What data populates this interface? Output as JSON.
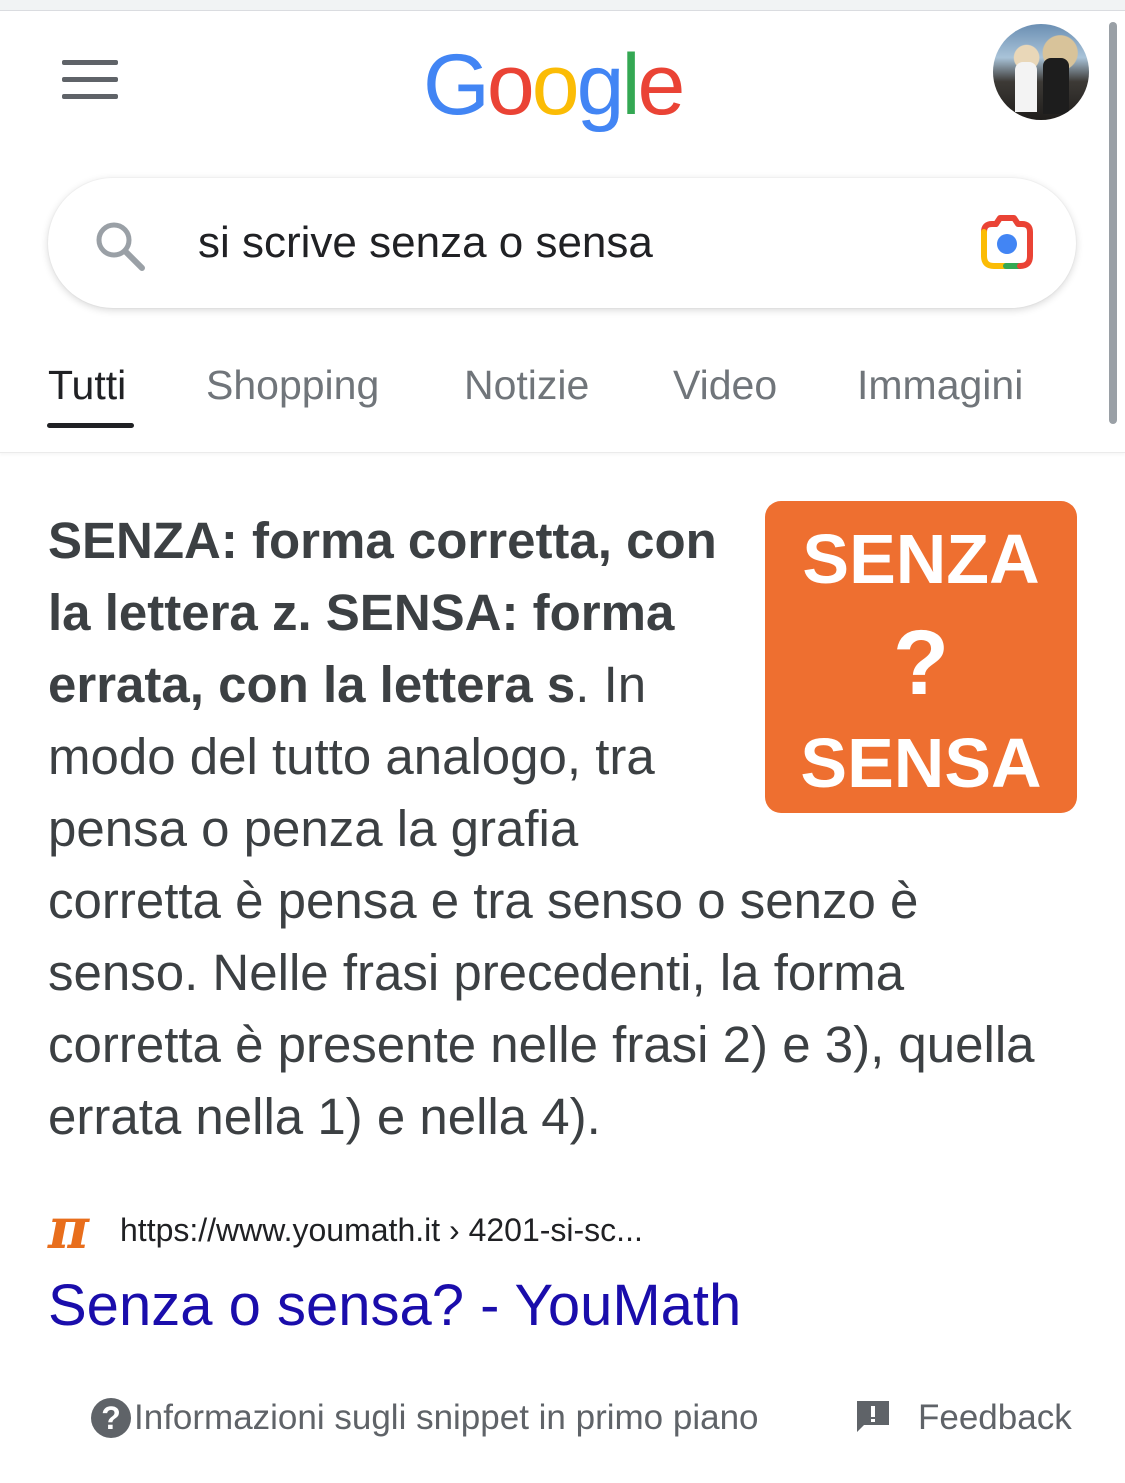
{
  "header": {
    "logo_letters": [
      {
        "char": "G",
        "color": "#4285f4"
      },
      {
        "char": "o",
        "color": "#ea4335"
      },
      {
        "char": "o",
        "color": "#fbbc05"
      },
      {
        "char": "g",
        "color": "#4285f4"
      },
      {
        "char": "l",
        "color": "#34a853"
      },
      {
        "char": "e",
        "color": "#ea4335"
      }
    ],
    "menu_icon": "hamburger-menu-icon",
    "avatar_icon": "account-avatar"
  },
  "search": {
    "query": "si scrive senza o sensa",
    "search_icon": "search-icon",
    "lens_icon": "google-lens-camera-icon"
  },
  "tabs": [
    {
      "label": "Tutti",
      "active": true
    },
    {
      "label": "Shopping",
      "active": false
    },
    {
      "label": "Notizie",
      "active": false
    },
    {
      "label": "Video",
      "active": false
    },
    {
      "label": "Immagini",
      "active": false
    }
  ],
  "snippet": {
    "bold_text": "SENZA: forma corretta, con la lettera z. SENSA: forma errata, con la lettera s",
    "rest_text": ". In modo del tutto analogo, tra pensa o penza la grafia corretta è pensa e tra senso o senzo è senso. Nelle frasi precedenti, la forma corretta è presente nelle frasi 2) e 3), quella errata nella 1) e nella 4).",
    "image": {
      "line1": "SENZA",
      "line2": "?",
      "line3": "SENSA",
      "background": "#ee6f30"
    }
  },
  "source": {
    "favicon_icon": "pi-icon",
    "url": "https://www.youmath.it › 4201-si-sc...",
    "title": "Senza o sensa? - YouMath"
  },
  "footer": {
    "info_icon": "help-circle-icon",
    "info_label": "Informazioni sugli snippet in primo piano",
    "feedback_icon": "feedback-icon",
    "feedback_label": "Feedback"
  },
  "colors": {
    "link": "#1a0dab",
    "text": "#3c4043",
    "tab_inactive": "#70757a"
  }
}
